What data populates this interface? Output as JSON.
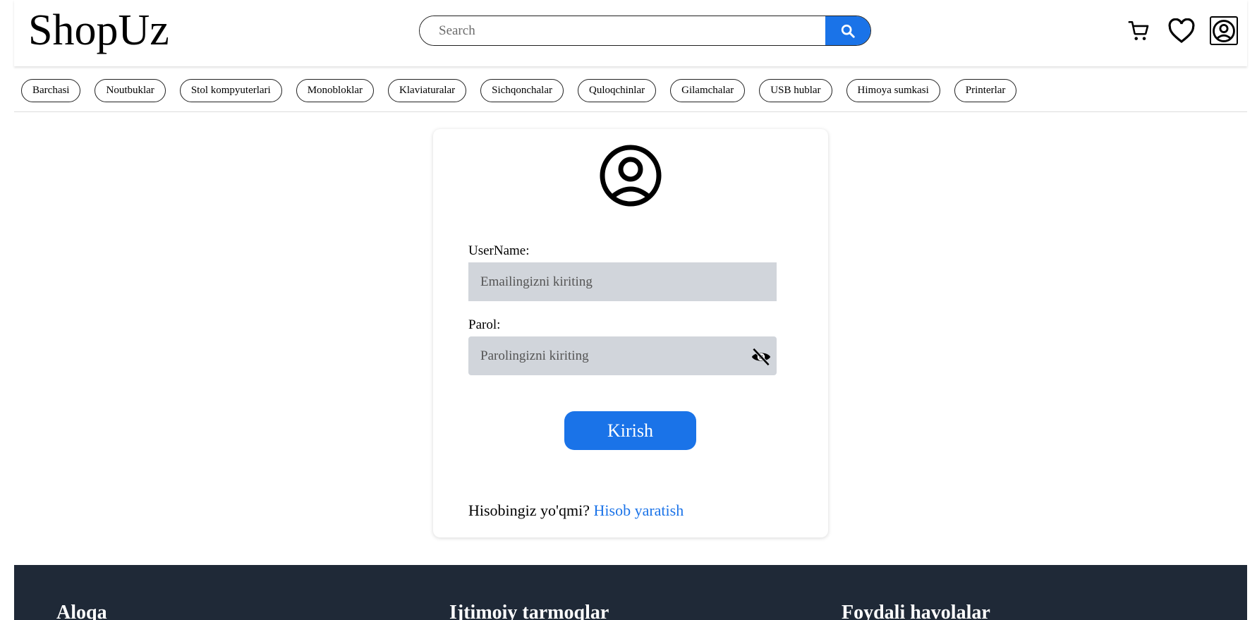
{
  "header": {
    "logo": "ShopUz",
    "search_placeholder": "Search",
    "icons": [
      "cart-icon",
      "heart-icon",
      "user-icon",
      "search-icon"
    ]
  },
  "categories": [
    "Barchasi",
    "Noutbuklar",
    "Stol kompyuterlari",
    "Monobloklar",
    "Klaviaturalar",
    "Sichqonchalar",
    "Quloqchinlar",
    "Gilamchalar",
    "USB hublar",
    "Himoya sumkasi",
    "Printerlar"
  ],
  "login": {
    "username_label": "UserName:",
    "username_placeholder": "Emailingizni kiriting",
    "password_label": "Parol:",
    "password_placeholder": "Parolingizni kiriting",
    "submit_label": "Kirish",
    "no_account_text": "Hisobingiz yo'qmi?",
    "signup_link": "Hisob yaratish"
  },
  "footer": {
    "col1": "Aloqa",
    "col2": "Ijtimoiy tarmoqlar",
    "col3": "Foydali havolalar"
  },
  "colors": {
    "accent": "#1a73e8",
    "input_bg": "#d1d5db",
    "footer_bg": "#1f2937"
  }
}
